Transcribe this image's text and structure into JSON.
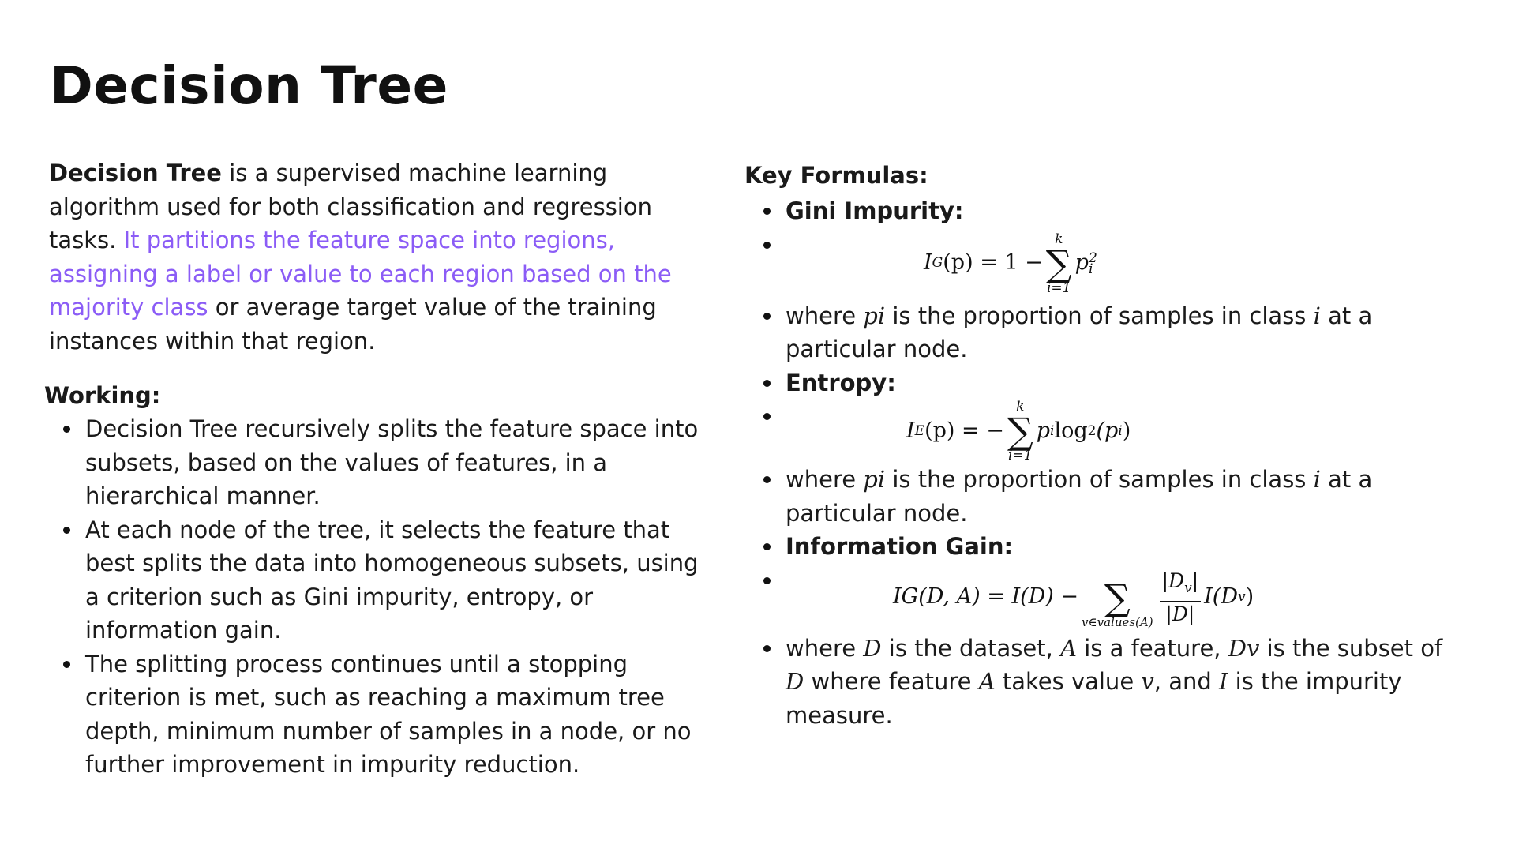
{
  "title": "Decision Tree",
  "intro": {
    "bold": "Decision Tree",
    "text1": " is a supervised machine learning algorithm used for both classification and regression tasks. ",
    "highlight": "It partitions the feature space into regions, assigning a label or value to each region based on the majority class",
    "text2": " or average target value of the training instances within that region."
  },
  "working": {
    "heading": "Working:",
    "items": [
      "Decision Tree recursively splits the feature space into subsets, based on the values of features, in a hierarchical manner.",
      "At each node of the tree, it selects the feature that best splits the data into homogeneous subsets, using a criterion such as Gini impurity, entropy, or information gain.",
      "The splitting process continues until a stopping criterion is met, such as reaching a maximum tree depth, minimum number of samples in a node, or no further improvement in impurity reduction."
    ]
  },
  "formulas": {
    "heading": "Key Formulas:",
    "gini_label": "Gini Impurity:",
    "entropy_label": "Entropy:",
    "ig_label": "Information Gain:",
    "where_p_a": "where ",
    "where_p_var": "pi",
    "where_p_b": " is the proportion of samples in class ",
    "where_p_var2": "i",
    "where_p_c": " at a particular node.",
    "ig_where": {
      "t1": "where ",
      "D": "D",
      "t2": " is the dataset, ",
      "A": "A",
      "t3": " is a feature, ",
      "Dv": "Dv",
      "t4": " is the subset of ",
      "D2": "D",
      "t5": " where feature ",
      "A2": "A",
      "t6": " takes value ",
      "v": "v",
      "t7": ", and ",
      "I": "I",
      "t8": " is the impurity measure."
    },
    "gini_formula": {
      "lhs_I": "I",
      "lhs_sub": "G",
      "lhs_arg": "(p) = 1 − ",
      "sum_top": "k",
      "sum_bot": "i=1",
      "term": "p",
      "term_sub": "i",
      "term_sup": "2"
    },
    "entropy_formula": {
      "lhs_I": "I",
      "lhs_sub": "E",
      "lhs_arg": "(p) = − ",
      "sum_top": "k",
      "sum_bot": "i=1",
      "term_p": "p",
      "term_p_sub": "i",
      "term_log": " log",
      "term_log_sub": "2",
      "term_arg": "(p",
      "term_arg_sub": "i",
      "term_close": ")"
    },
    "ig_formula": {
      "lhs": "IG(D, A) = I(D) − ",
      "sum_bot": "v∈values(A)",
      "num": "|D",
      "num_sub": "v",
      "num_close": "|",
      "den": "|D|",
      "rhs": "I(D",
      "rhs_sub": "v",
      "rhs_close": ")"
    }
  }
}
